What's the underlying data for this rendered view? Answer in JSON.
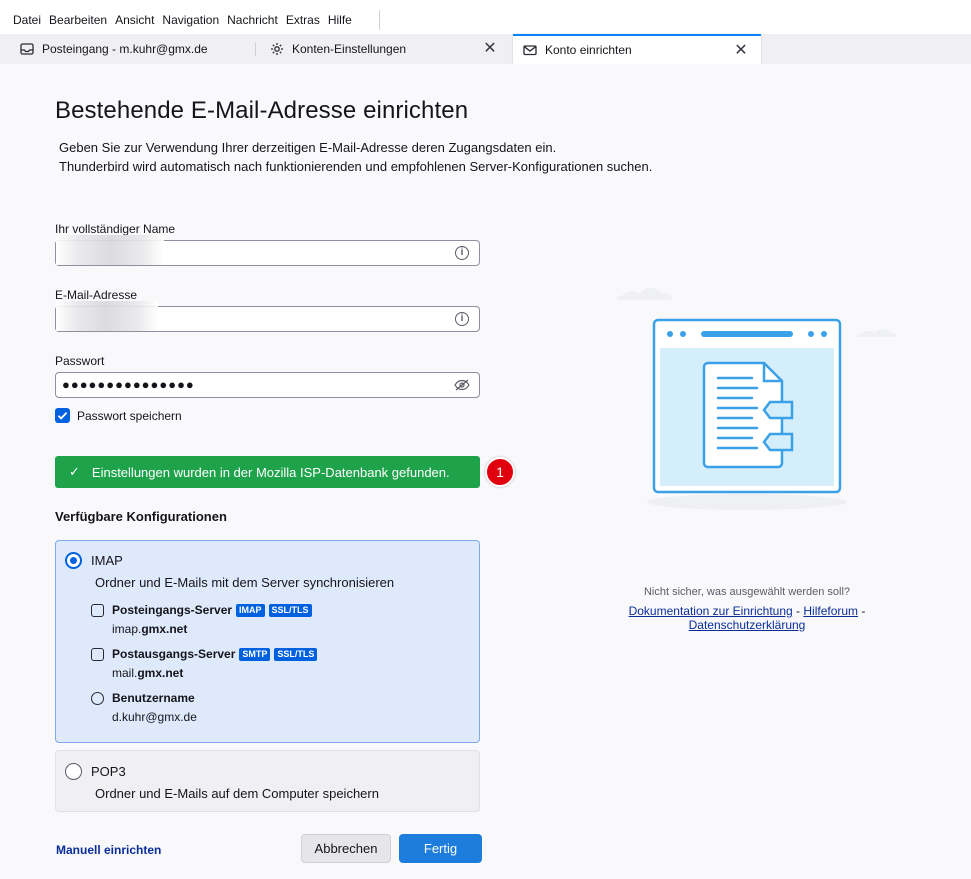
{
  "menu": {
    "items": [
      {
        "label": "Datei"
      },
      {
        "label": "Bearbeiten"
      },
      {
        "label": "Ansicht"
      },
      {
        "label": "Navigation"
      },
      {
        "label": "Nachricht"
      },
      {
        "label": "Extras"
      },
      {
        "label": "Hilfe"
      }
    ]
  },
  "tabs": [
    {
      "label": "Posteingang - m.kuhr@gmx.de",
      "icon": "inbox-icon"
    },
    {
      "label": "Konten-Einstellungen",
      "icon": "gear-icon"
    },
    {
      "label": "Konto einrichten",
      "icon": "envelope-icon"
    }
  ],
  "page": {
    "title": "Bestehende E-Mail-Adresse einrichten",
    "desc_line1": "Geben Sie zur Verwendung Ihrer derzeitigen E-Mail-Adresse deren Zugangsdaten ein.",
    "desc_line2": "Thunderbird wird automatisch nach funktionierenden und empfohlenen Server-Konfigurationen suchen."
  },
  "form": {
    "name_label": "Ihr vollständiger Name",
    "email_label": "E-Mail-Adresse",
    "password_label": "Passwort",
    "password_dots": "●●●●●●●●●●●●●●●",
    "remember_label": "Passwort speichern",
    "remember_checked": true
  },
  "status": {
    "message": "Einstellungen wurden in der Mozilla ISP-Datenbank gefunden.",
    "badge": "1",
    "color": "#1fa34a"
  },
  "configs": {
    "heading": "Verfügbare Konfigurationen",
    "imap": {
      "title": "IMAP",
      "subtitle": "Ordner und E-Mails mit dem Server synchronisieren",
      "incoming_label": "Posteingangs-Server",
      "incoming_tag1": "IMAP",
      "incoming_tag2": "SSL/TLS",
      "incoming_host_pre": "imap.",
      "incoming_host_bold": "gmx.net",
      "outgoing_label": "Postausgangs-Server",
      "outgoing_tag1": "SMTP",
      "outgoing_tag2": "SSL/TLS",
      "outgoing_host_pre": "mail.",
      "outgoing_host_bold": "gmx.net",
      "username_label": "Benutzername",
      "username": "d.kuhr@gmx.de",
      "selected": true
    },
    "pop3": {
      "title": "POP3",
      "subtitle": "Ordner und E-Mails auf dem Computer speichern",
      "selected": false
    }
  },
  "actions": {
    "manual": "Manuell einrichten",
    "cancel": "Abbrechen",
    "done": "Fertig"
  },
  "help": {
    "question": "Nicht sicher, was ausgewählt werden soll?",
    "link1": "Dokumentation zur Einrichtung",
    "sep": " - ",
    "link2": "Hilfeforum",
    "link3": "Datenschutzerklärung"
  }
}
